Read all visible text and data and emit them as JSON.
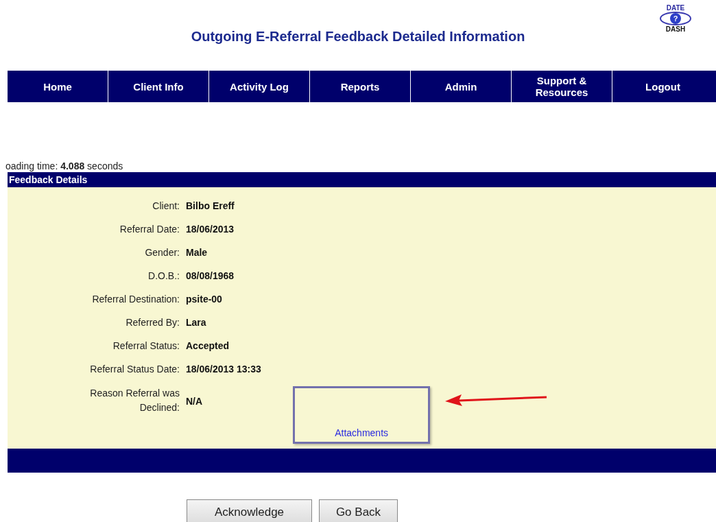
{
  "page_title": "Outgoing E-Referral Feedback Detailed Information",
  "logo": {
    "top": "DATE",
    "center": "?",
    "bottom": "DASH"
  },
  "nav": [
    "Home",
    "Client Info",
    "Activity Log",
    "Reports",
    "Admin",
    "Support & Resources",
    "Logout"
  ],
  "loading_time": "oading time: **4.088** seconds",
  "section_title": "Feedback Details",
  "fields": [
    {
      "label": "Client:",
      "value": "Bilbo Ereff"
    },
    {
      "label": "Referral Date:",
      "value": "18/06/2013"
    },
    {
      "label": "Gender:",
      "value": "Male"
    },
    {
      "label": "D.O.B.:",
      "value": "08/08/1968"
    },
    {
      "label": "Referral Destination:",
      "value": "psite-00"
    },
    {
      "label": "Referred By:",
      "value": "Lara"
    },
    {
      "label": "Referral Status:",
      "value": "Accepted"
    },
    {
      "label": "Referral Status Date:",
      "value": "18/06/2013 13:33"
    }
  ],
  "declined": {
    "label": "Reason Referral was Declined:",
    "value": "N/A"
  },
  "attachments_link": "Attachments",
  "buttons": [
    "Acknowledge",
    "Go Back"
  ]
}
